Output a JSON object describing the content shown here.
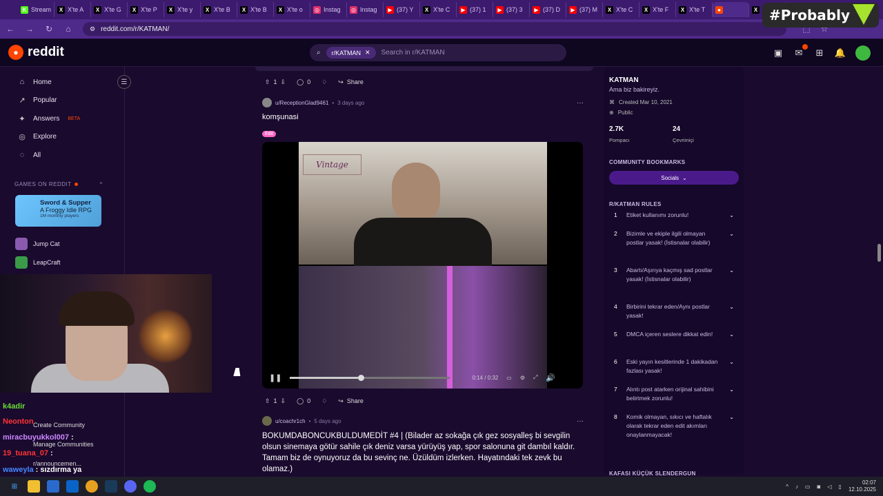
{
  "browser": {
    "tabs": [
      {
        "label": "Stream",
        "icon": "K",
        "color": "#53fc18"
      },
      {
        "label": "X'te A",
        "icon": "X",
        "color": "#000000"
      },
      {
        "label": "X'te G",
        "icon": "X",
        "color": "#000000"
      },
      {
        "label": "X'te P",
        "icon": "X",
        "color": "#000000"
      },
      {
        "label": "X'te y",
        "icon": "X",
        "color": "#000000"
      },
      {
        "label": "X'te B",
        "icon": "X",
        "color": "#000000"
      },
      {
        "label": "X'te B",
        "icon": "X",
        "color": "#000000"
      },
      {
        "label": "X'te o",
        "icon": "X",
        "color": "#000000"
      },
      {
        "label": "Instag",
        "icon": "◎",
        "color": "#e1306c"
      },
      {
        "label": "Instag",
        "icon": "◎",
        "color": "#e1306c"
      },
      {
        "label": "(37) Y",
        "icon": "▶",
        "color": "#ff0000"
      },
      {
        "label": "X'te C",
        "icon": "X",
        "color": "#000000"
      },
      {
        "label": "(37) 1",
        "icon": "▶",
        "color": "#ff0000"
      },
      {
        "label": "(37) 3",
        "icon": "▶",
        "color": "#ff0000"
      },
      {
        "label": "(37) D",
        "icon": "▶",
        "color": "#ff0000"
      },
      {
        "label": "(37) M",
        "icon": "▶",
        "color": "#ff0000"
      },
      {
        "label": "X'te C",
        "icon": "X",
        "color": "#000000"
      },
      {
        "label": "X'te F",
        "icon": "X",
        "color": "#000000"
      },
      {
        "label": "X'te T",
        "icon": "X",
        "color": "#000000"
      },
      {
        "label": "",
        "icon": "●",
        "color": "#ff4500",
        "active": true
      },
      {
        "label": "X'te",
        "icon": "X",
        "color": "#000000"
      }
    ],
    "url": "reddit.com/r/KATMAN/",
    "overlay_tag": "#Probably"
  },
  "header": {
    "logo": "reddit",
    "search_chip": "r/KATMAN",
    "search_placeholder": "Search in r/KATMAN"
  },
  "sidebar": {
    "items": [
      {
        "label": "Home",
        "icon": "⌂"
      },
      {
        "label": "Popular",
        "icon": "↗"
      },
      {
        "label": "Answers",
        "icon": "✦",
        "badge": "BETA"
      },
      {
        "label": "Explore",
        "icon": "◎"
      },
      {
        "label": "All",
        "icon": "◌"
      }
    ],
    "games_header": "GAMES ON REDDIT",
    "game_card": {
      "title": "Sword & Supper",
      "subtitle": "A Froggy Idle RPG",
      "players": "1M monthly players"
    },
    "games": [
      {
        "label": "Jump Cat"
      },
      {
        "label": "LeapCraft"
      }
    ],
    "community_items": [
      {
        "label": "Create Community"
      },
      {
        "label": "Manage Communities"
      },
      {
        "label": "r/announcemen..."
      }
    ]
  },
  "chat": [
    {
      "user": "k4adir",
      "text": "",
      "color": "#66dd33"
    },
    {
      "user": "Neonton",
      "text": "",
      "color": "#ff3333"
    },
    {
      "user": "miracbuyukkol007",
      "text": ":",
      "color": "#cc88ff"
    },
    {
      "user": "19_tuana_07",
      "text": ":",
      "color": "#ff3333"
    },
    {
      "user": "waweyla",
      "text": ": sızdırma ya",
      "color": "#4488ff"
    }
  ],
  "feed": {
    "top_bar": {
      "votes": "1",
      "comments": "0",
      "share": "Share"
    },
    "post1": {
      "author": "u/ReceptionGlad9461",
      "time": "3 days ago",
      "title": "komşunasi",
      "flair": "Edit",
      "video_overlay": "Vintage",
      "video_time": "0:14 / 0:32",
      "progress": 0.44,
      "bar": {
        "votes": "1",
        "comments": "0",
        "share": "Share"
      }
    },
    "post2": {
      "author": "u/coachr1ch",
      "time": "5 days ago",
      "title": "BOKUMDABONCUKBULDUMEDİT #4 | (Bilader az sokağa çık gez sosyalleş bi sevgilin olsun sinemaya götür sahile çık deniz varsa yürüyüş yap, spor salonuna git dambıl kaldır. Tamam biz de oynuyoruz da bu sevinç ne. Üzüldüm izlerken. Hayatındaki tek zevk bu olamaz.)"
    }
  },
  "community": {
    "name": "KATMAN",
    "description": "Ama biz bakireyiz.",
    "created": "Created Mar 10, 2021",
    "visibility": "Public",
    "members": "2.7K",
    "members_label": "Pompacı",
    "online": "24",
    "online_label": "Çevrimiçi",
    "bookmarks_header": "COMMUNITY BOOKMARKS",
    "bookmark_button": "Socials",
    "rules_header": "R/KATMAN RULES",
    "rules": [
      {
        "n": "1",
        "text": "Etiket kullanımı zorunlu!"
      },
      {
        "n": "2",
        "text": "Bizimle ve ekiple ilgili olmayan postlar yasak! (İstisnalar olabilir)"
      },
      {
        "n": "3",
        "text": "Abartı/Aşırıya kaçmış sad postlar yasak! (İstisnalar olabilir)"
      },
      {
        "n": "4",
        "text": "Birbirini tekrar eden/Aynı postlar yasak!"
      },
      {
        "n": "5",
        "text": "DMCA içeren seslere dikkat edin!"
      },
      {
        "n": "6",
        "text": "Eski yayın kesitlerinde 1 dakikadan fazlası yasak!"
      },
      {
        "n": "7",
        "text": "Alıntı post atarken orijinal sahibini belirtmek zorunlu!"
      },
      {
        "n": "8",
        "text": "Komik olmayan, sıkıcı ve haftalık olarak tekrar eden edit akımları onaylanmayacak!"
      }
    ],
    "next_header": "KAFASI KÜÇÜK SLENDERGUN"
  },
  "taskbar": {
    "time": "02:07",
    "date": "12.10.2025"
  }
}
